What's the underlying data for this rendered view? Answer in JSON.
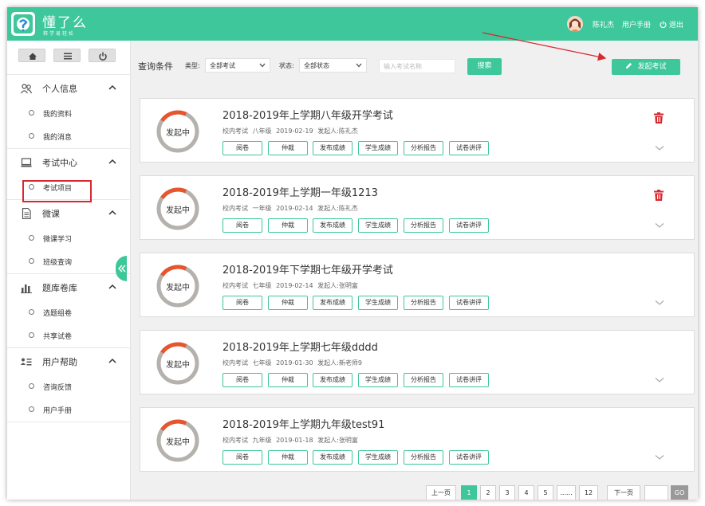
{
  "header": {
    "title": "懂了么",
    "subtitle": "释学易轻松",
    "user_name": "陈礼杰",
    "manual": "用户手册",
    "logout": "退出"
  },
  "sidebar": {
    "groups": [
      {
        "label": "个人信息",
        "items": [
          "我的资料",
          "我的消息"
        ]
      },
      {
        "label": "考试中心",
        "items": [
          "考试项目"
        ]
      },
      {
        "label": "微课",
        "items": [
          "微课学习",
          "班级查询"
        ]
      },
      {
        "label": "题库卷库",
        "items": [
          "选题组卷",
          "共享试卷"
        ]
      },
      {
        "label": "用户帮助",
        "items": [
          "咨询反馈",
          "用户手册"
        ]
      }
    ]
  },
  "filter": {
    "label": "查询条件",
    "type_label": "类型:",
    "type_value": "全部考试",
    "status_label": "状态:",
    "status_value": "全部状态",
    "search_placeholder": "输入考试名称",
    "search_button": "搜索",
    "create_button": "发起考试"
  },
  "action_labels": [
    "阅卷",
    "仲裁",
    "发布成绩",
    "学生成绩",
    "分析报告",
    "试卷讲评"
  ],
  "exams": [
    {
      "status": "发起中",
      "title": "2018-2019年上学期八年级开学考试",
      "type": "校内考试",
      "grade": "八年级",
      "date": "2019-02-19",
      "creator_label": "发起人:",
      "creator": "陈礼杰",
      "deletable": true
    },
    {
      "status": "发起中",
      "title": "2018-2019年上学期一年级1213",
      "type": "校内考试",
      "grade": "一年级",
      "date": "2019-02-14",
      "creator_label": "发起人:",
      "creator": "陈礼杰",
      "deletable": true
    },
    {
      "status": "发起中",
      "title": "2018-2019年下学期七年级开学考试",
      "type": "校内考试",
      "grade": "七年级",
      "date": "2019-02-14",
      "creator_label": "发起人:",
      "creator": "张明富",
      "deletable": false
    },
    {
      "status": "发起中",
      "title": "2018-2019年上学期七年级dddd",
      "type": "校内考试",
      "grade": "七年级",
      "date": "2019-01-30",
      "creator_label": "发起人:",
      "creator": "新老师9",
      "deletable": false
    },
    {
      "status": "发起中",
      "title": "2018-2019年上学期九年级test91",
      "type": "校内考试",
      "grade": "九年级",
      "date": "2019-01-18",
      "creator_label": "发起人:",
      "creator": "张明富",
      "deletable": false
    }
  ],
  "pagination": {
    "prev": "上一页",
    "pages": [
      "1",
      "2",
      "3",
      "4",
      "5",
      "......",
      "12"
    ],
    "current": "1",
    "next": "下一页",
    "go": "GO"
  },
  "colors": {
    "accent": "#3ec79a",
    "ring": "#e8542c",
    "danger": "#d8282f"
  }
}
